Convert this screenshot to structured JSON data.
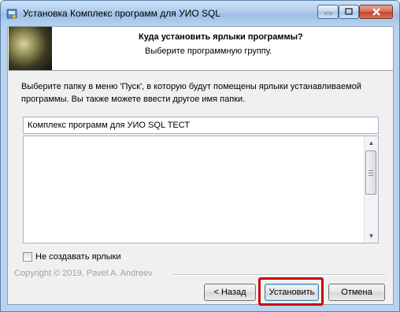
{
  "window": {
    "title": "Установка Комплекс программ для УИО SQL",
    "icons": [
      "installer-icon",
      "minimize-icon",
      "maximize-icon",
      "close-icon"
    ]
  },
  "header": {
    "title": "Куда установить ярлыки программы?",
    "subtitle": "Выберите программную группу."
  },
  "body": {
    "description": "Выберите папку в меню 'Пуск', в которую будут помещены ярлыки устанавливаемой программы. Вы также можете ввести другое имя папки.",
    "folder_value": "Комплекс программ для УИО SQL ТЕСТ",
    "folder_list": [],
    "no_shortcuts_label": "Не создавать ярлыки",
    "no_shortcuts_checked": false
  },
  "footer": {
    "copyright": "Copyright © 2019, Pavel A. Andreev",
    "back_label": "< Назад",
    "install_label": "Установить",
    "cancel_label": "Отмена"
  },
  "colors": {
    "highlight": "#cc0000",
    "titlebar": "#a9c8e9",
    "close_button": "#c2442a"
  }
}
